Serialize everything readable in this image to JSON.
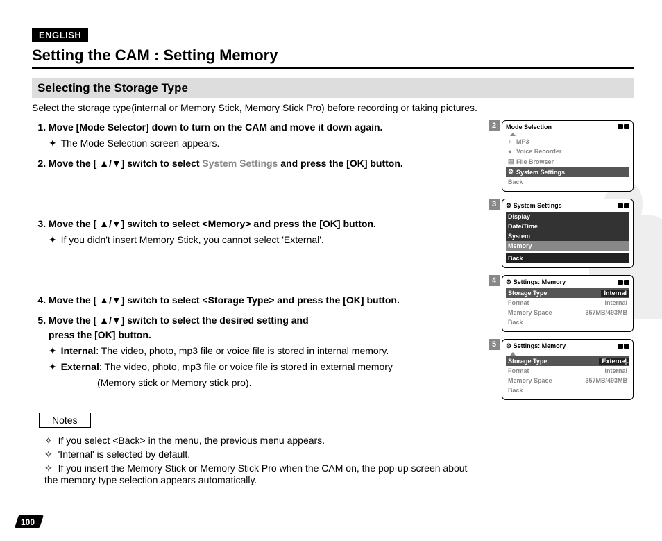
{
  "lang": "ENGLISH",
  "title": "Setting the CAM : Setting Memory",
  "subtitle": "Selecting the Storage Type",
  "intro": "Select the storage type(internal or Memory Stick, Memory Stick Pro) before recording or taking pictures.",
  "steps": {
    "s1": "Move [Mode Selector] down to turn on the CAM and move it down again.",
    "s1a": "The Mode Selection screen appears.",
    "s2a": "Move the [ ▲/▼] switch to select ",
    "s2b": "System Settings",
    "s2c": " and press the [OK] button.",
    "s3": "Move the [ ▲/▼] switch to select <Memory> and press the [OK] button.",
    "s3a": "If you didn't insert Memory Stick, you cannot select 'External'.",
    "s4": "Move the [ ▲/▼] switch to select <Storage Type> and press the [OK] button.",
    "s5": "Move the [ ▲/▼] switch to select the desired setting and",
    "s5b": "press the [OK] button.",
    "s5c_label": "Internal",
    "s5c_text": ": The video, photo, mp3 file or voice file is stored in internal memory.",
    "s5d_label": "External",
    "s5d_text": ": The video, photo, mp3 file or voice file is stored in external memory",
    "s5d_text2": "(Memory stick or Memory stick pro)."
  },
  "notes_label": "Notes",
  "notes": {
    "n1": "If you select <Back> in the menu, the previous menu appears.",
    "n2": "'Internal' is selected by default.",
    "n3": "If you insert the Memory Stick or Memory Stick Pro when the CAM on, the pop-up screen about the memory type selection appears automatically."
  },
  "page": "100",
  "screens": {
    "sc2": {
      "num": "2",
      "title": "Mode Selection",
      "items": [
        "MP3",
        "Voice Recorder",
        "File Browser",
        "System Settings",
        "Back"
      ],
      "icons": [
        "♪",
        "●",
        "▤",
        "⚙"
      ]
    },
    "sc3": {
      "num": "3",
      "title": "System Settings",
      "items": [
        "Display",
        "Date/Time",
        "System",
        "Memory",
        "Back"
      ]
    },
    "sc4": {
      "num": "4",
      "title": "Settings: Memory",
      "rows": [
        {
          "label": "Storage Type",
          "val": "Internal"
        },
        {
          "label": "Format",
          "val": "Internal"
        },
        {
          "label": "Memory Space",
          "val": "357MB/493MB"
        },
        {
          "label": "Back",
          "val": ""
        }
      ]
    },
    "sc5": {
      "num": "5",
      "title": "Settings: Memory",
      "rows": [
        {
          "label": "Storage Type",
          "val": "External"
        },
        {
          "label": "Format",
          "val": "Internal"
        },
        {
          "label": "Memory Space",
          "val": "357MB/493MB"
        },
        {
          "label": "Back",
          "val": ""
        }
      ]
    }
  }
}
